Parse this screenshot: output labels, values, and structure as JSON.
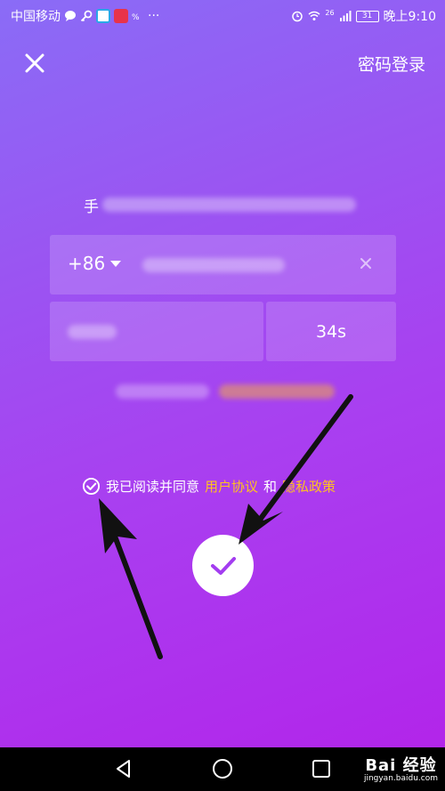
{
  "status_bar": {
    "carrier": "中国移动",
    "network": "26",
    "battery": "31",
    "time": "晚上9:10"
  },
  "header": {
    "close_icon": "close-icon",
    "password_login": "密码登录"
  },
  "subtitle": {
    "visible_char": "手"
  },
  "phone_field": {
    "country_code": "+86"
  },
  "code_row": {
    "countdown": "34s"
  },
  "agreement": {
    "prefix": "我已阅读并同意",
    "user_agreement": "用户协议",
    "conjunction": "和",
    "privacy_policy": "隐私政策"
  },
  "submit": {
    "icon": "check-icon"
  },
  "watermark": {
    "main": "Bai 经验",
    "sub": "jingyan.baidu.com"
  },
  "colors": {
    "link": "#ffc21f",
    "bg_top": "#8a6cf6",
    "bg_bottom": "#b225ea",
    "accent": "#a33df0"
  }
}
